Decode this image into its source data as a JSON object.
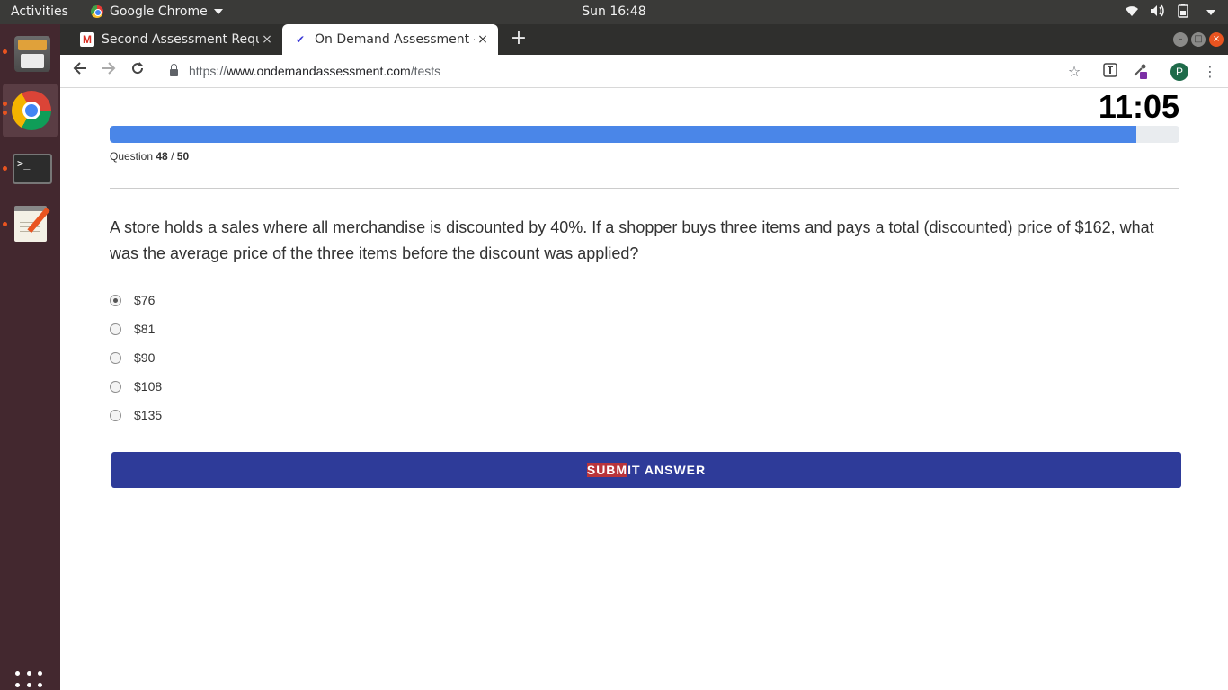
{
  "topbar": {
    "activities": "Activities",
    "app_name": "Google Chrome",
    "clock": "Sun 16:48",
    "tray_icons": [
      "wifi-icon",
      "volume-icon",
      "battery-icon",
      "system-menu-caret-icon"
    ]
  },
  "dock": {
    "items": [
      "files",
      "google-chrome",
      "terminal",
      "text-editor",
      "show-applications"
    ],
    "terminal_prompt": ">_"
  },
  "browser": {
    "tabs": [
      {
        "title": "Second Assessment Requ",
        "favicon": "gmail-icon",
        "active": false,
        "close": "×"
      },
      {
        "title": "On Demand Assessment -",
        "favicon": "checkmark-icon",
        "active": true,
        "close": "×"
      }
    ],
    "new_tab": "+",
    "url": {
      "scheme": "https://",
      "host": "www.ondemandassessment.com",
      "path": "/tests"
    },
    "profile_initial": "P"
  },
  "test": {
    "timer": "11:05",
    "progress_fraction": 0.96,
    "question_label": "Question",
    "question_current": "48",
    "question_separator": "/",
    "question_total": "50",
    "question_text": "A store holds a sales where all merchandise is discounted by 40%. If a shopper buys three items and pays a total (discounted) price of $162, what was the average price of the three items before the discount was applied?",
    "options": [
      {
        "label": "$76",
        "selected": true
      },
      {
        "label": "$81",
        "selected": false
      },
      {
        "label": "$90",
        "selected": false
      },
      {
        "label": "$108",
        "selected": false
      },
      {
        "label": "$135",
        "selected": false
      }
    ],
    "submit_highlight": "SUBM",
    "submit_rest": "IT ANSWER"
  },
  "colors": {
    "progress": "#4a86e8",
    "submit_bg": "#2e3b99",
    "submit_highlight": "#b9343b",
    "dock_bg": "#43282f",
    "ubuntu_orange": "#e95420"
  }
}
